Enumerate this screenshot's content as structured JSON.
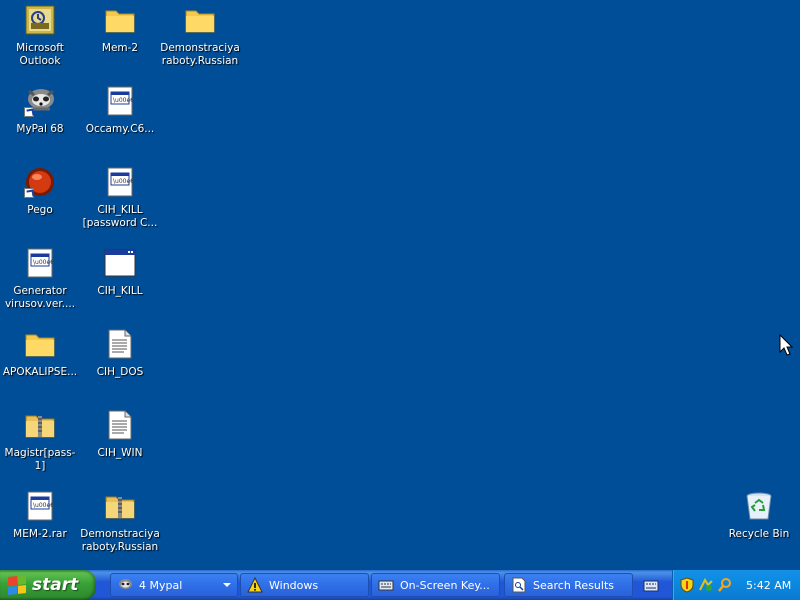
{
  "desktop": {
    "icons": [
      {
        "label": "Microsoft Outlook",
        "icon": "outlook-icon"
      },
      {
        "label": "Mem-2",
        "icon": "folder-icon"
      },
      {
        "label": "Demonstraciya raboty.Russian",
        "icon": "folder-icon"
      },
      {
        "label": "MyPal 68",
        "icon": "mypal-icon"
      },
      {
        "label": "Occamy.C6...",
        "icon": "executable-icon"
      },
      {
        "label": "Pego",
        "icon": "pego-icon"
      },
      {
        "label": "CIH_KILL [password C...",
        "icon": "executable-icon"
      },
      {
        "label": "Generator virusov.ver....",
        "icon": "executable-icon"
      },
      {
        "label": "CIH_KILL",
        "icon": "window-icon"
      },
      {
        "label": "APOKALIPSE...",
        "icon": "folder-icon"
      },
      {
        "label": "CIH_DOS",
        "icon": "text-document-icon"
      },
      {
        "label": "Magistr[pass-1]",
        "icon": "zip-folder-icon"
      },
      {
        "label": "CIH_WIN",
        "icon": "text-document-icon"
      },
      {
        "label": "MEM-2.rar",
        "icon": "executable-icon"
      },
      {
        "label": "Demonstraciya raboty.Russian",
        "icon": "zip-folder-icon"
      },
      {
        "label": "Recycle Bin",
        "icon": "recycle-bin-icon"
      }
    ]
  },
  "taskbar": {
    "start_label": "start",
    "buttons": [
      {
        "label": "4 Mypal",
        "icon": "mypal-icon"
      },
      {
        "label": "Windows",
        "icon": "warning-icon"
      },
      {
        "label": "On-Screen Key...",
        "icon": "keyboard-icon"
      },
      {
        "label": "Search Results",
        "icon": "search-document-icon"
      }
    ],
    "tray": {
      "clock": "5:42 AM",
      "icons": [
        "security-shield-icon",
        "network-icon",
        "search-icon"
      ]
    }
  },
  "colors": {
    "desktop": "#004e98",
    "taskbar": "#2157d7",
    "start": "#38a238",
    "tray": "#0c8ae2"
  }
}
